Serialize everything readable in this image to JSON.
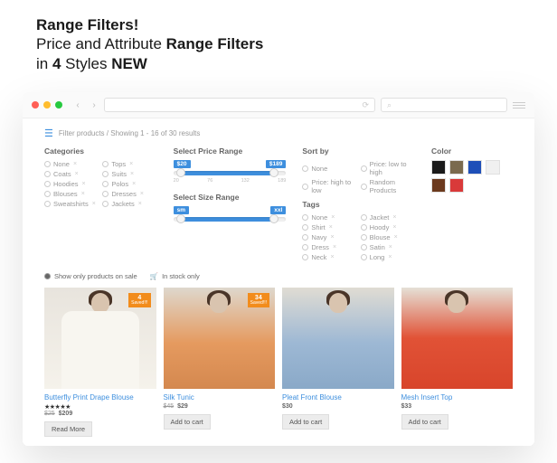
{
  "heading": {
    "title": "Range Filters!",
    "line2_pre": "Price and Attribute ",
    "line2_bold": "Range Filters",
    "line3_pre": "in ",
    "line3_bold1": "4",
    "line3_mid": " Styles ",
    "line3_bold2": "NEW"
  },
  "breadcrumb": "Filter products / Showing 1 - 16 of 30 results",
  "filters": {
    "categories": {
      "title": "Categories",
      "items": [
        "None",
        "Tops",
        "Coats",
        "Suits",
        "Hoodies",
        "Polos",
        "Blouses",
        "Dresses",
        "Sweatshirts",
        "Jackets"
      ]
    },
    "price": {
      "title": "Select Price Range",
      "min": "$20",
      "max": "$189",
      "ticks": [
        "20",
        "76",
        "132",
        "189"
      ]
    },
    "size": {
      "title": "Select Size Range",
      "min": "sm",
      "max": "xxl"
    },
    "sort": {
      "title": "Sort by",
      "items": [
        "None",
        "Price: low to high",
        "Price: high to low",
        "Random Products"
      ]
    },
    "tags": {
      "title": "Tags",
      "items": [
        "None",
        "Jacket",
        "Shirt",
        "Hoody",
        "Navy",
        "Blouse",
        "Dress",
        "Satin",
        "Neck",
        "Long"
      ]
    },
    "color": {
      "title": "Color",
      "swatches": [
        "#1a1a1a",
        "#7a6a4e",
        "#1e4fb8",
        "#f0f0f0",
        "#6b3a1e",
        "#d93a3a"
      ]
    }
  },
  "toggles": {
    "sale": "Show only products on sale",
    "stock": "In stock only"
  },
  "products": [
    {
      "name": "Butterfly Print Drape Blouse",
      "rating": 5,
      "price_old": "$25",
      "price": "$209",
      "btn": "Read More",
      "badge": null
    },
    {
      "name": "Silk Tunic",
      "rating": null,
      "price_old": "$45",
      "price": "$29",
      "btn": "Add to cart",
      "badge": {
        "pct": "34",
        "off": "Saved!!!"
      }
    },
    {
      "name": "Pleat Front Blouse",
      "rating": null,
      "price_old": null,
      "price": "$30",
      "btn": "Add to cart",
      "badge": null
    },
    {
      "name": "Mesh Insert Top",
      "rating": null,
      "price_old": null,
      "price": "$33",
      "btn": "Add to cart",
      "badge": null
    }
  ]
}
